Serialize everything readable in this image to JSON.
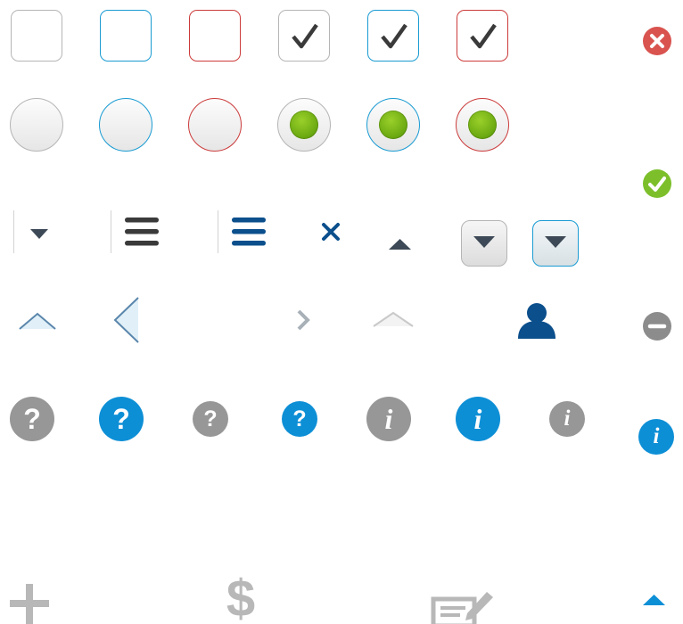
{
  "colors": {
    "neutral_border": "#b5b5b5",
    "focus_border": "#1a9bd2",
    "error_border": "#cc3b3b",
    "check_mark": "#3a3a3a",
    "radio_selected": "#6caa12",
    "navy_icon": "#0b4f8c",
    "info_blue": "#0d8fd6",
    "help_gray": "#979797",
    "error_red": "#d9534f",
    "success_green": "#7cbf2b",
    "disabled_gray": "#8c8c8c",
    "caret_dark": "#3d4956",
    "light_gray": "#b8b8b8"
  },
  "icons": {
    "help_glyph": "?",
    "info_glyph": "i",
    "close_glyph": "×",
    "dollar_glyph": "$"
  }
}
